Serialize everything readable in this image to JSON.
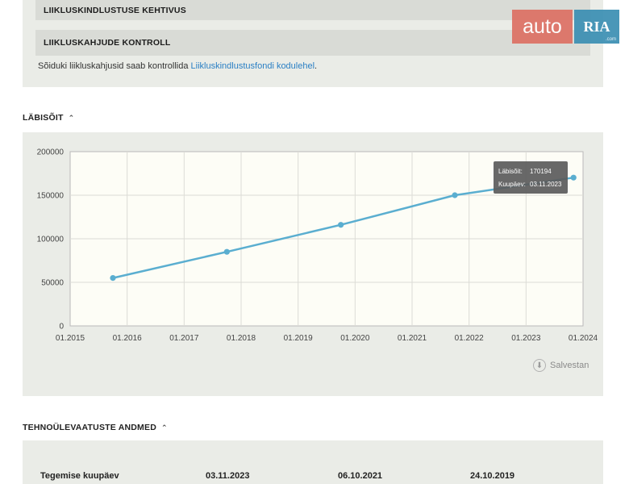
{
  "sections": {
    "insurance_validity": "LIIKLUSKINDLUSTUSE KEHTIVUS",
    "damage_control": "LIIKLUSKAHJUDE KONTROLL",
    "note_text": "Sõiduki liikluskahjusid saab kontrollida ",
    "note_link": "Liikluskindlustusfondi kodulehel",
    "note_end": "."
  },
  "logo": {
    "auto": "auto",
    "ria": "RIA",
    "com": ".com"
  },
  "mileage": {
    "heading": "LÄBISÕIT",
    "chevron": "⌃",
    "save_label": "Salvestan",
    "tooltip_label_mileage": "Läbisõit:",
    "tooltip_value_mileage": "170194",
    "tooltip_label_date": "Kuupäev:",
    "tooltip_value_date": "03.11.2023"
  },
  "chart_data": {
    "type": "line",
    "x_axis": {
      "min": "2015-01",
      "max": "2024-01",
      "ticks": [
        "01.2015",
        "01.2016",
        "01.2017",
        "01.2018",
        "01.2019",
        "01.2020",
        "01.2021",
        "01.2022",
        "01.2023",
        "01.2024"
      ]
    },
    "y_axis": {
      "min": 0,
      "max": 200000,
      "ticks": [
        0,
        50000,
        100000,
        150000,
        200000
      ]
    },
    "grid": true,
    "line_color": "#5aaed0",
    "points": [
      {
        "date": "2015-10",
        "value": 55000
      },
      {
        "date": "2017-10",
        "value": 85000
      },
      {
        "date": "2019-10",
        "value": 116000
      },
      {
        "date": "2021-10",
        "value": 150000
      },
      {
        "date": "2023-11",
        "value": 170194
      }
    ]
  },
  "inspections": {
    "heading": "TEHNOÜLEVAATUSTE ANDMED",
    "chevron": "⌃",
    "row_label": "Tegemise kuupäev",
    "dates": [
      "03.11.2023",
      "06.10.2021",
      "24.10.2019"
    ]
  }
}
